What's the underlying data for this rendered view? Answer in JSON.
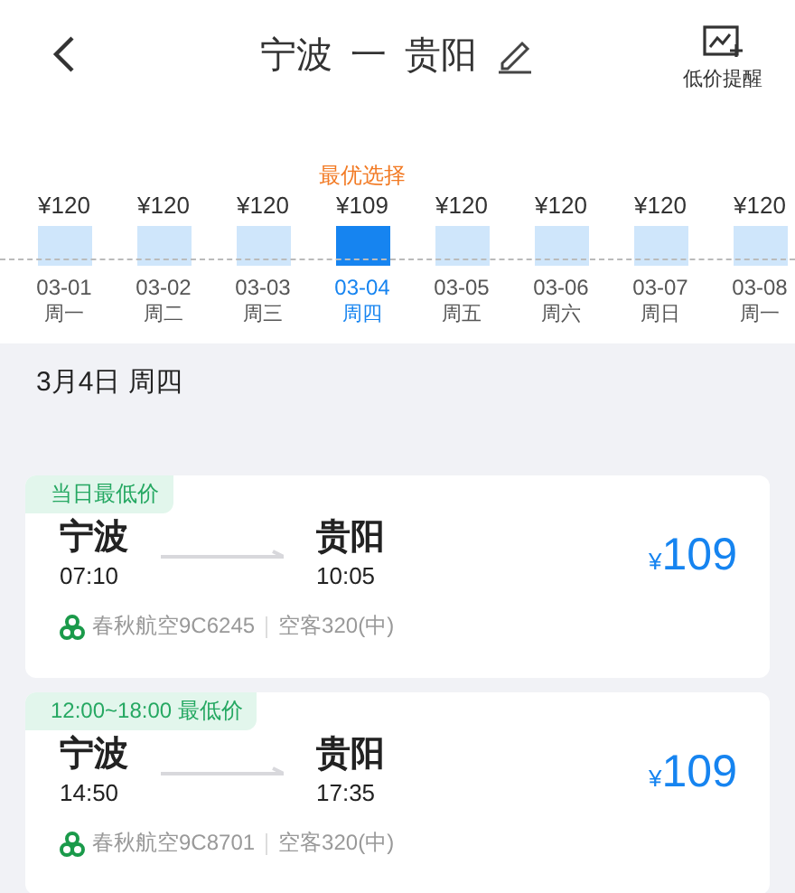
{
  "header": {
    "from": "宁波",
    "separator": "一",
    "to": "贵阳",
    "alert_label": "低价提醒"
  },
  "dates": [
    {
      "price": "¥120",
      "date": "03-01",
      "weekday": "周一",
      "selected": false
    },
    {
      "price": "¥120",
      "date": "03-02",
      "weekday": "周二",
      "selected": false
    },
    {
      "price": "¥120",
      "date": "03-03",
      "weekday": "周三",
      "selected": false
    },
    {
      "badge": "最优选择",
      "price": "¥109",
      "date": "03-04",
      "weekday": "周四",
      "selected": true
    },
    {
      "price": "¥120",
      "date": "03-05",
      "weekday": "周五",
      "selected": false
    },
    {
      "price": "¥120",
      "date": "03-06",
      "weekday": "周六",
      "selected": false
    },
    {
      "price": "¥120",
      "date": "03-07",
      "weekday": "周日",
      "selected": false
    },
    {
      "price": "¥120",
      "date": "03-08",
      "weekday": "周一",
      "selected": false
    }
  ],
  "day_header": "3月4日 周四",
  "flights": [
    {
      "tag": "当日最低价",
      "from": "宁波",
      "depart": "07:10",
      "to": "贵阳",
      "arrive": "10:05",
      "currency": "¥",
      "price": "109",
      "airline": "春秋航空9C6245",
      "aircraft": "空客320(中)"
    },
    {
      "tag": "12:00~18:00 最低价",
      "from": "宁波",
      "depart": "14:50",
      "to": "贵阳",
      "arrive": "17:35",
      "currency": "¥",
      "price": "109",
      "airline": "春秋航空9C8701",
      "aircraft": "空客320(中)"
    }
  ]
}
